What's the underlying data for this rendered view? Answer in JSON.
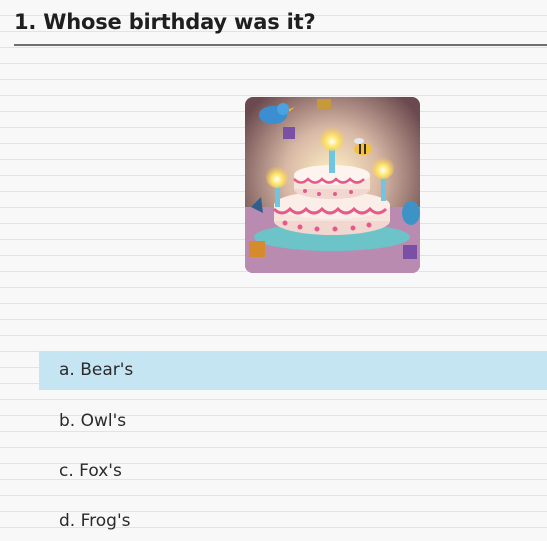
{
  "question": {
    "title": "1. Whose birthday was it?"
  },
  "image": {
    "subject": "birthday-cake-illustration"
  },
  "answers": [
    {
      "label": "a. Bear's",
      "selected": true
    },
    {
      "label": "b. Owl's",
      "selected": false
    },
    {
      "label": "c. Fox's",
      "selected": false
    },
    {
      "label": "d. Frog's",
      "selected": false
    }
  ],
  "colors": {
    "selected_highlight": "#c6e5f3",
    "divider": "#6f6f6f"
  }
}
